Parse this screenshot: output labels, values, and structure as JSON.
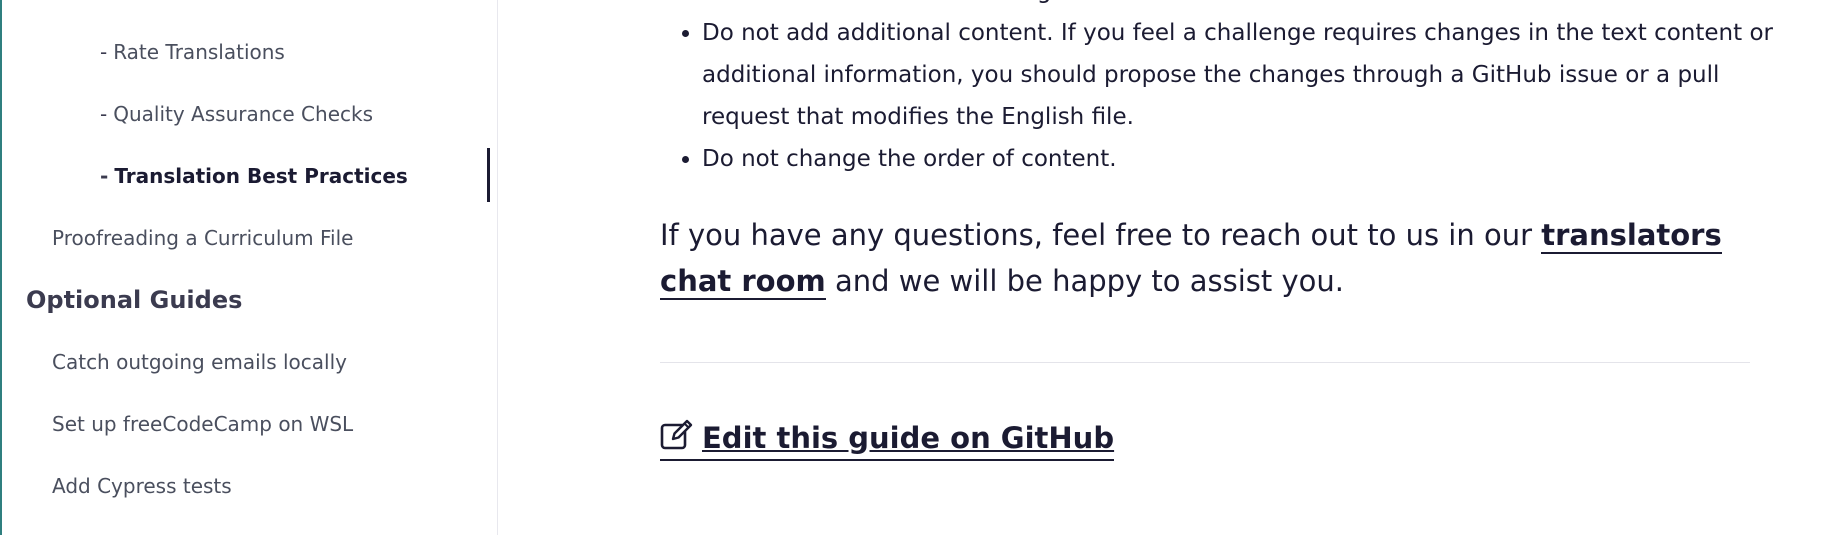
{
  "sidebar": {
    "items": [
      {
        "label": "Rate Translations"
      },
      {
        "label": "Quality Assurance Checks"
      },
      {
        "label": "Translation Best Practices"
      },
      {
        "label": "Proofreading a Curriculum File"
      }
    ],
    "section_heading": "Optional Guides",
    "optional_items": [
      {
        "label": "Catch outgoing emails locally"
      },
      {
        "label": "Set up freeCodeCamp on WSL"
      },
      {
        "label": "Add Cypress tests"
      }
    ],
    "sub_prefix": "-"
  },
  "main": {
    "clipped_line": "code and should be left in English.",
    "bullets": [
      "Do not add additional content. If you feel a challenge requires changes in the text content or additional information, you should propose the changes through a GitHub issue or a pull request that modifies the English file.",
      "Do not change the order of content."
    ],
    "paragraph_before": "If you have any questions, feel free to reach out to us in our ",
    "paragraph_link": "translators chat room",
    "paragraph_after": " and we will be happy to assist you.",
    "edit_link": "Edit this guide on GitHub",
    "edit_icon": "edit-icon"
  },
  "colors": {
    "text": "#1b1b32",
    "muted": "#4a4f5e",
    "accent_edge": "#2f7f7f"
  }
}
